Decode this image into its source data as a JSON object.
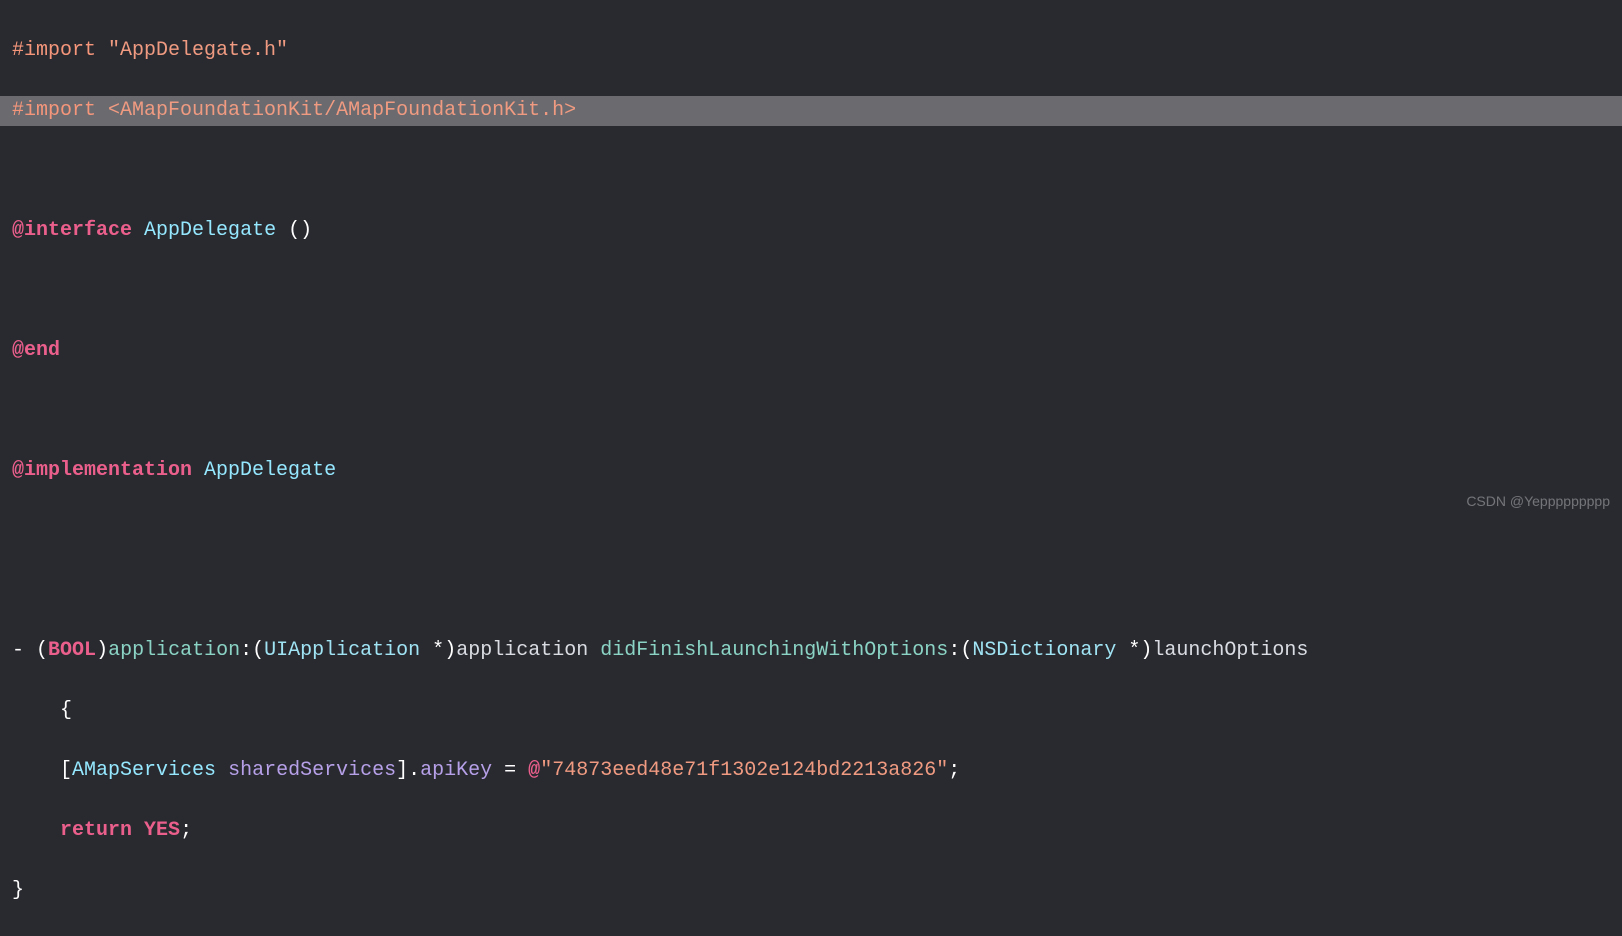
{
  "lines": {
    "l1": {
      "preproc": "#import",
      "string": "\"AppDelegate.h\""
    },
    "l2": {
      "preproc": "#import",
      "string": "<AMapFoundationKit/AMapFoundationKit.h>"
    },
    "l4": {
      "at_kw": "@interface",
      "type": "AppDelegate",
      "parens": "()"
    },
    "l6": {
      "at_kw": "@end"
    },
    "l8": {
      "at_kw": "@implementation",
      "type": "AppDelegate"
    },
    "l11": {
      "dash": "-",
      "open_paren": "(",
      "ret_type": "BOOL",
      "close_paren": ")",
      "sel1": "application",
      "colon1": ":",
      "open_paren2": "(",
      "param_type1": "UIApplication",
      "star1": " *",
      "close_paren2": ")",
      "param1": "application",
      "sel2": "didFinishLaunchingWithOptions",
      "colon2": ":",
      "open_paren3": "(",
      "param_type2": "NSDictionary",
      "star2": " *",
      "close_paren3": ")",
      "param2": "launchOptions"
    },
    "l12": {
      "brace": "{"
    },
    "l13": {
      "open_bracket": "[",
      "class": "AMapServices",
      "method": "sharedServices",
      "close_bracket": "]",
      "dot": ".",
      "property": "apiKey",
      "equals": " = ",
      "string_prefix": "@",
      "string": "\"74873eed48e71f1302e124bd2213a826\"",
      "semi": ";"
    },
    "l14": {
      "return_kw": "return",
      "yes": "YES",
      "semi": ";"
    },
    "l15": {
      "brace": "}"
    }
  },
  "watermark": "CSDN @Yeppppppppp"
}
